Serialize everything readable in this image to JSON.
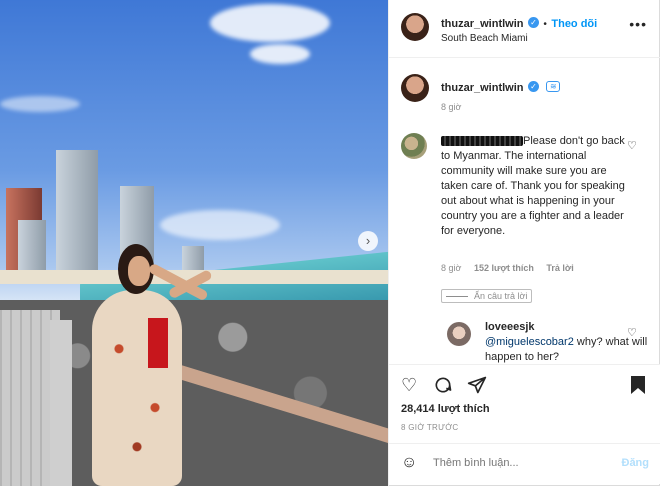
{
  "header": {
    "username": "thuzar_wintlwin",
    "follow_label": "Theo dõi",
    "location": "South Beach Miami",
    "more": "•••"
  },
  "caption": {
    "username": "thuzar_wintlwin",
    "time": "8 giờ"
  },
  "comment": {
    "text": "Please don't go back to Myanmar. The international community will make sure you are taken care of. Thank you for speaking out about what is happening in your country you are a fighter and a leader for everyone.",
    "time": "8 giờ",
    "likes": "152 lượt thích",
    "reply_label": "Trả lời",
    "hide_replies": "Ẩn câu trả lời"
  },
  "reply": {
    "username": "loveeesjk",
    "mention": "@miguelescobar2",
    "text": " why? what will happen to her?"
  },
  "post": {
    "likes": "28,414 lượt thích",
    "time": "8 GIỜ TRƯỚC",
    "comment_placeholder": "Thêm bình luận...",
    "post_label": "Đăng"
  },
  "icons": {
    "verified": "verified-badge-icon",
    "heart": "heart-icon",
    "comment": "comment-icon",
    "share": "send-icon",
    "save": "bookmark-icon",
    "emoji": "smiley-icon",
    "next": "chevron-right-icon"
  }
}
